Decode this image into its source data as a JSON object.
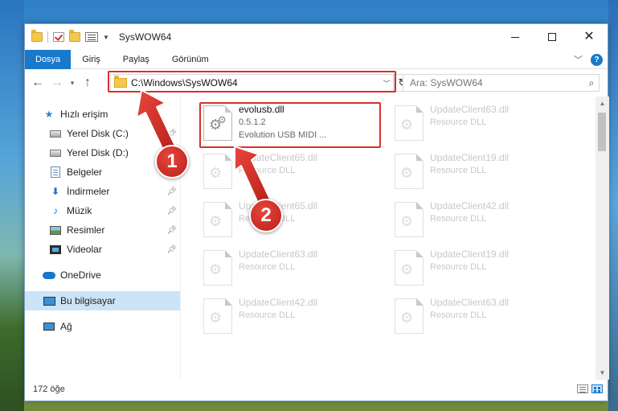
{
  "window": {
    "title": "SysWOW64"
  },
  "ribbon": {
    "tabs": [
      {
        "label": "Dosya"
      },
      {
        "label": "Giriş"
      },
      {
        "label": "Paylaş"
      },
      {
        "label": "Görünüm"
      }
    ]
  },
  "navbar": {
    "address": "C:\\Windows\\SysWOW64",
    "search_placeholder": "Ara: SysWOW64"
  },
  "sidebar": {
    "items": [
      {
        "label": "Hızlı erişim",
        "icon": "star-icon"
      },
      {
        "label": "Yerel Disk (C:)",
        "icon": "drive-icon",
        "pinned": true
      },
      {
        "label": "Yerel Disk (D:)",
        "icon": "drive-icon",
        "pinned": false
      },
      {
        "label": "Belgeler",
        "icon": "document-icon",
        "pinned": true
      },
      {
        "label": "İndirmeler",
        "icon": "download-icon",
        "pinned": true
      },
      {
        "label": "Müzik",
        "icon": "music-icon",
        "pinned": true
      },
      {
        "label": "Resimler",
        "icon": "pictures-icon",
        "pinned": true
      },
      {
        "label": "Videolar",
        "icon": "videos-icon",
        "pinned": true
      },
      {
        "label": "OneDrive",
        "icon": "cloud-icon"
      },
      {
        "label": "Bu bilgisayar",
        "icon": "computer-icon",
        "selected": true
      },
      {
        "label": "Ağ",
        "icon": "network-icon"
      }
    ]
  },
  "files": {
    "highlighted": {
      "name": "evolusb.dll",
      "version": "0.5.1.2",
      "description": "Evolution USB MIDI ..."
    },
    "ghost_left": [
      {
        "name": "UpdateClient65.dll",
        "description": "Resource DLL"
      },
      {
        "name": "UpdateClient65.dll",
        "description": "Resource DLL"
      },
      {
        "name": "UpdateClient63.dll",
        "description": "Resource DLL"
      },
      {
        "name": "UpdateClient42.dll",
        "description": "Resource DLL"
      }
    ],
    "ghost_right": [
      {
        "name": "UpdateClient63.dll",
        "description": "Resource DLL"
      },
      {
        "name": "UpdateClient19.dll",
        "description": "Resource DLL"
      },
      {
        "name": "UpdateClient42.dll",
        "description": "Resource DLL"
      },
      {
        "name": "UpdateClient19.dll",
        "description": "Resource DLL"
      },
      {
        "name": "UpdateClient63.dll",
        "description": "Resource DLL"
      }
    ]
  },
  "status": {
    "count": "172 öğe"
  },
  "callouts": {
    "one": "1",
    "two": "2",
    "color": "#d9302a"
  }
}
